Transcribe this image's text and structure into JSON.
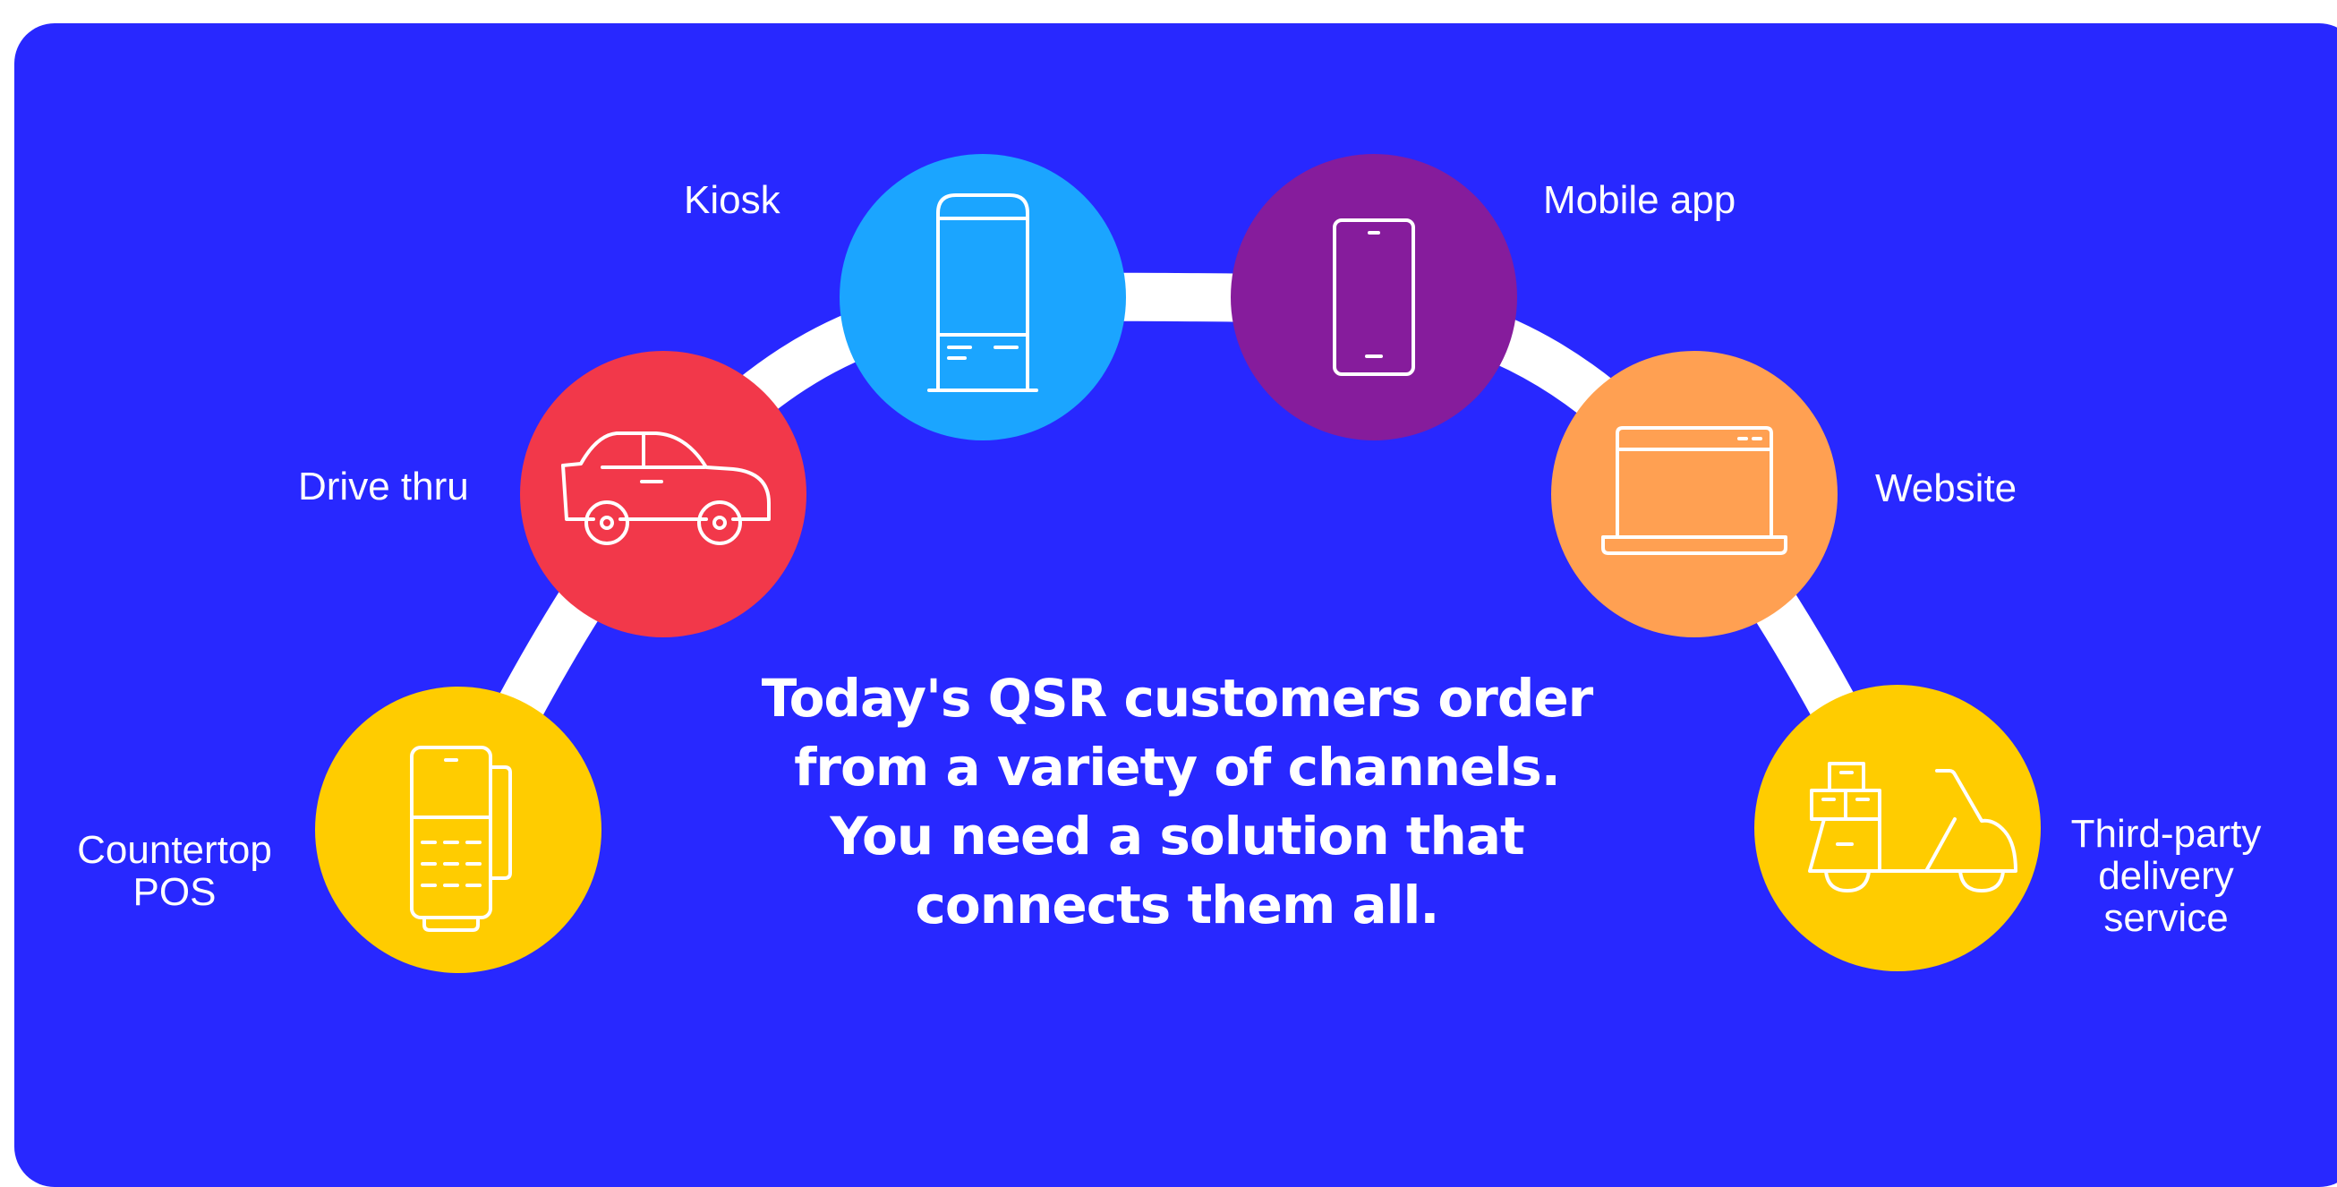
{
  "diagram": {
    "colors": {
      "background": "#2828FF",
      "arc": "#FFFFFF",
      "countertop_pos": "#FFCC00",
      "drive_thru": "#F2384A",
      "kiosk": "#1BA5FF",
      "mobile_app": "#861C9C",
      "website": "#FFA052",
      "third_party_delivery": "#FFCC00"
    },
    "channels": [
      {
        "id": "countertop_pos",
        "label_lines": [
          "Countertop",
          "POS"
        ],
        "icon": "payment-terminal-icon"
      },
      {
        "id": "drive_thru",
        "label": "Drive thru",
        "icon": "car-icon"
      },
      {
        "id": "kiosk",
        "label": "Kiosk",
        "icon": "kiosk-icon"
      },
      {
        "id": "mobile_app",
        "label": "Mobile app",
        "icon": "smartphone-icon"
      },
      {
        "id": "website",
        "label": "Website",
        "icon": "laptop-icon"
      },
      {
        "id": "third_party_delivery",
        "label_lines": [
          "Third-party",
          "delivery",
          "service"
        ],
        "icon": "delivery-scooter-icon"
      }
    ],
    "headline_lines": [
      "Today's QSR customers order",
      "from a variety of channels.",
      "You need a solution that",
      "connects them all."
    ]
  }
}
